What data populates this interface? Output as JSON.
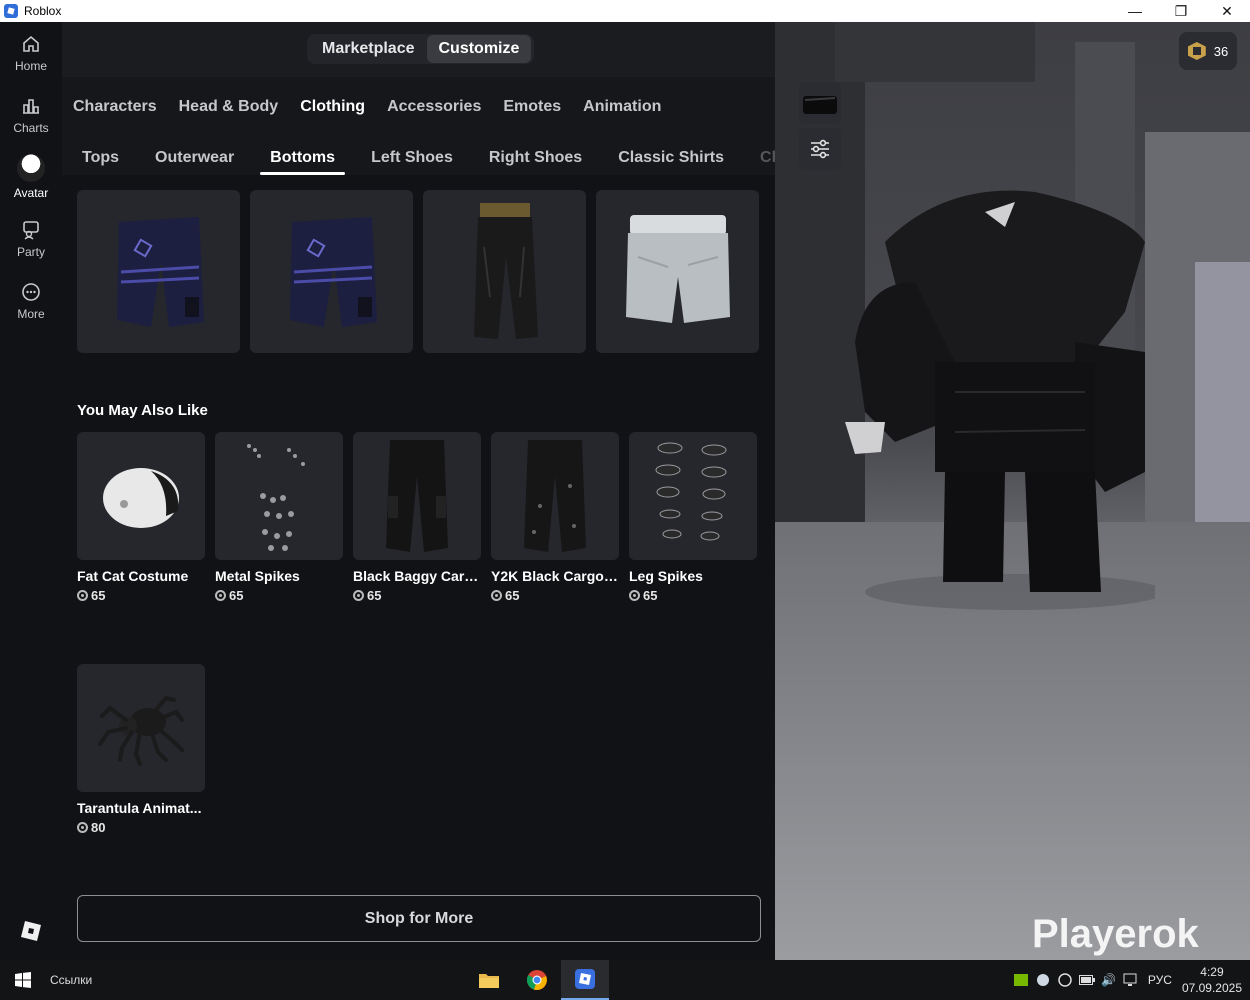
{
  "window": {
    "title": "Roblox"
  },
  "rail": {
    "items": [
      {
        "label": "Home",
        "icon": "home-icon"
      },
      {
        "label": "Charts",
        "icon": "charts-icon"
      },
      {
        "label": "Avatar",
        "icon": "avatar-icon"
      },
      {
        "label": "Party",
        "icon": "party-icon"
      },
      {
        "label": "More",
        "icon": "more-icon"
      }
    ]
  },
  "switcher": {
    "marketplace": "Marketplace",
    "customize": "Customize"
  },
  "categories": [
    "Characters",
    "Head & Body",
    "Clothing",
    "Accessories",
    "Emotes",
    "Animation"
  ],
  "subcategories": [
    "Tops",
    "Outerwear",
    "Bottoms",
    "Left Shoes",
    "Right Shoes",
    "Classic Shirts",
    "Cl"
  ],
  "recommendations": {
    "title": "You May Also Like",
    "items": [
      {
        "name": "Fat Cat Costume",
        "price": "65"
      },
      {
        "name": "Metal Spikes",
        "price": "65"
      },
      {
        "name": "Black Baggy Carg...",
        "price": "65"
      },
      {
        "name": "Y2K Black Cargo ...",
        "price": "65"
      },
      {
        "name": "Leg Spikes",
        "price": "65"
      },
      {
        "name": "Tarantula Animat...",
        "price": "80"
      }
    ]
  },
  "shop_button": "Shop for More",
  "robux_balance": "36",
  "watermark": "Playerok",
  "taskbar": {
    "links": "Ссылки",
    "lang": "РУС",
    "time": "4:29",
    "date": "07.09.2025"
  },
  "colors": {
    "accent_robux": "#c8a24a",
    "panel_bg": "#111216",
    "card_bg": "#25272d"
  }
}
